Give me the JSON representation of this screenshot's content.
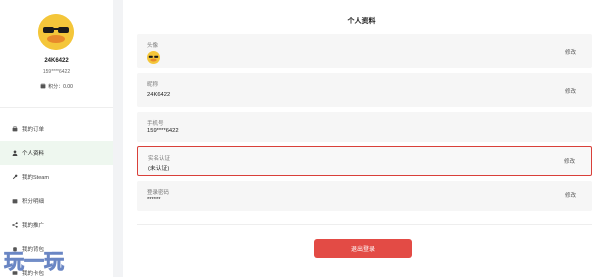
{
  "profile": {
    "username": "24K6422",
    "phone": "159****6422",
    "points_label": "积分：",
    "points_value": "0.00"
  },
  "sidebar": {
    "items": [
      {
        "label": "我的订单",
        "icon": "bag-icon"
      },
      {
        "label": "个人资料",
        "icon": "user-icon",
        "active": true
      },
      {
        "label": "我的Steam",
        "icon": "wrench-icon"
      },
      {
        "label": "积分明细",
        "icon": "coins-icon"
      },
      {
        "label": "我的推广",
        "icon": "share-icon"
      },
      {
        "label": "我的背包",
        "icon": "backpack-icon"
      },
      {
        "label": "我的卡包",
        "icon": "card-icon"
      }
    ]
  },
  "main": {
    "title": "个人资料",
    "fields": [
      {
        "label": "头像",
        "edit": "修改"
      },
      {
        "label": "昵称",
        "value": "24K6422",
        "edit": "修改"
      },
      {
        "label": "手机号",
        "value": "159****6422"
      },
      {
        "label": "实名认证",
        "value": "(未认证)",
        "edit": "修改"
      },
      {
        "label": "登录密码",
        "value": "******",
        "edit": "修改"
      }
    ],
    "logout_label": "退出登录"
  },
  "watermark": {
    "text": "玩一玩"
  },
  "colors": {
    "accent_red": "#e34b45",
    "highlight_border": "#d9403a",
    "active_bg": "#eef7ef"
  }
}
